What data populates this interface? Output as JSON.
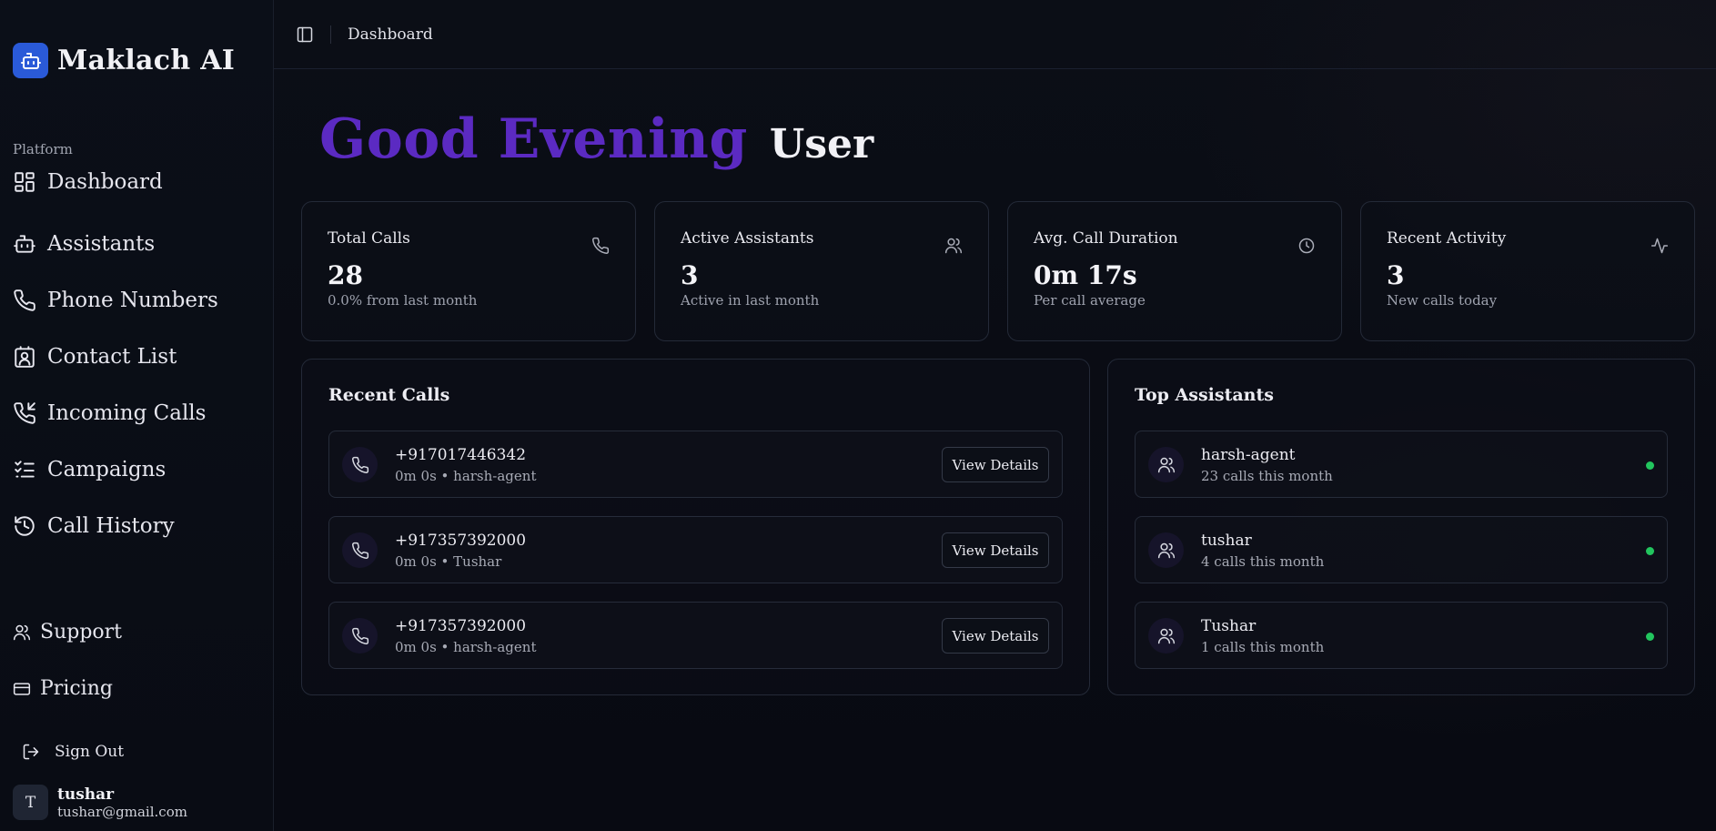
{
  "brand": {
    "name": "Maklach AI"
  },
  "sidebar": {
    "section_label": "Platform",
    "items": [
      {
        "label": "Dashboard",
        "icon": "dashboard-icon"
      },
      {
        "label": "Assistants",
        "icon": "bot-icon"
      },
      {
        "label": "Phone Numbers",
        "icon": "phone-icon"
      },
      {
        "label": "Contact List",
        "icon": "contact-icon"
      },
      {
        "label": "Incoming Calls",
        "icon": "incoming-call-icon"
      },
      {
        "label": "Campaigns",
        "icon": "checklist-icon"
      },
      {
        "label": "Call History",
        "icon": "history-icon"
      }
    ],
    "support_label": "Support",
    "pricing_label": "Pricing",
    "signout_label": "Sign Out",
    "user": {
      "initial": "T",
      "name": "tushar",
      "email": "tushar@gmail.com"
    }
  },
  "header": {
    "breadcrumb": "Dashboard"
  },
  "greeting": {
    "salutation": "Good Evening",
    "name": "User",
    "accent_color": "#5b2ac2"
  },
  "stats": [
    {
      "title": "Total Calls",
      "value": "28",
      "sub": "0.0% from last month",
      "icon": "phone-icon"
    },
    {
      "title": "Active Assistants",
      "value": "3",
      "sub": "Active in last month",
      "icon": "users-icon"
    },
    {
      "title": "Avg. Call Duration",
      "value": "0m 17s",
      "sub": "Per call average",
      "icon": "clock-icon"
    },
    {
      "title": "Recent Activity",
      "value": "3",
      "sub": "New calls today",
      "icon": "activity-icon"
    }
  ],
  "recent_calls": {
    "title": "Recent Calls",
    "button_label": "View Details",
    "items": [
      {
        "number": "+917017446342",
        "detail": "0m 0s • harsh-agent"
      },
      {
        "number": "+917357392000",
        "detail": "0m 0s • Tushar"
      },
      {
        "number": "+917357392000",
        "detail": "0m 0s • harsh-agent"
      }
    ]
  },
  "top_assistants": {
    "title": "Top Assistants",
    "status_color": "#22c55e",
    "items": [
      {
        "name": "harsh-agent",
        "detail": "23 calls this month"
      },
      {
        "name": "tushar",
        "detail": "4 calls this month"
      },
      {
        "name": "Tushar",
        "detail": "1 calls this month"
      }
    ]
  }
}
